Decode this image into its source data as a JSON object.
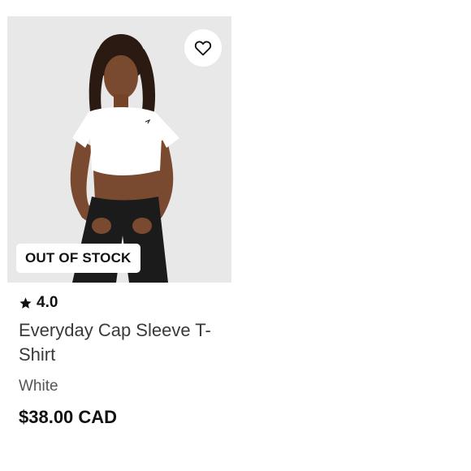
{
  "product": {
    "badge": "OUT OF STOCK",
    "rating": "4.0",
    "title": "Everyday Cap Sleeve T-Shirt",
    "color": "White",
    "price": "$38.00 CAD",
    "wishlist_icon": "heart-outline-icon",
    "rating_icon": "star-icon"
  }
}
